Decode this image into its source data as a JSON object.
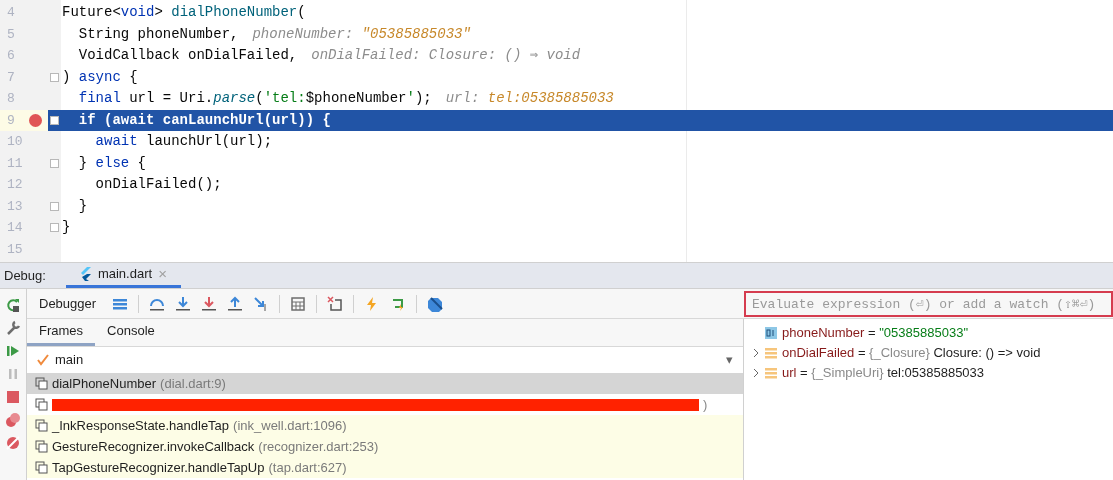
{
  "editor": {
    "lines": [
      {
        "number": "4",
        "breakpoint": false,
        "current": false,
        "fold": false,
        "tokens": [
          {
            "text": "Future<",
            "kind": "plain"
          },
          {
            "text": "void",
            "kind": "keyword"
          },
          {
            "text": "> ",
            "kind": "plain"
          },
          {
            "text": "dialPhoneNumber",
            "kind": "function"
          },
          {
            "text": "(",
            "kind": "plain"
          }
        ]
      },
      {
        "number": "5",
        "breakpoint": false,
        "current": false,
        "fold": false,
        "tokens": [
          {
            "text": "  String phoneNumber,",
            "kind": "plain"
          }
        ],
        "hint": [
          {
            "text": "phoneNumber: ",
            "kind": "label"
          },
          {
            "text": "\"05385885033\"",
            "kind": "value"
          }
        ]
      },
      {
        "number": "6",
        "breakpoint": false,
        "current": false,
        "fold": false,
        "tokens": [
          {
            "text": "  VoidCallback onDialFailed,",
            "kind": "plain"
          }
        ],
        "hint": [
          {
            "text": "onDialFailed: Closure: () ⇒ void",
            "kind": "label"
          }
        ]
      },
      {
        "number": "7",
        "breakpoint": false,
        "current": false,
        "fold": true,
        "tokens": [
          {
            "text": ") ",
            "kind": "plain"
          },
          {
            "text": "async",
            "kind": "keyword"
          },
          {
            "text": " {",
            "kind": "plain"
          }
        ]
      },
      {
        "number": "8",
        "breakpoint": false,
        "current": false,
        "fold": false,
        "tokens": [
          {
            "text": "  final",
            "kind": "keyword"
          },
          {
            "text": " url = Uri.",
            "kind": "plain"
          },
          {
            "text": "parse",
            "kind": "method"
          },
          {
            "text": "(",
            "kind": "plain"
          },
          {
            "text": "'tel:",
            "kind": "string"
          },
          {
            "text": "$phoneNumber",
            "kind": "plain"
          },
          {
            "text": "'",
            "kind": "string"
          },
          {
            "text": ");",
            "kind": "plain"
          }
        ],
        "hint": [
          {
            "text": "url: ",
            "kind": "label"
          },
          {
            "text": "tel:05385885033",
            "kind": "value"
          }
        ]
      },
      {
        "number": "9",
        "breakpoint": true,
        "current": true,
        "fold": true,
        "tokens": [
          {
            "text": "  if (await canLaunchUrl(url)) {",
            "kind": "plain"
          }
        ]
      },
      {
        "number": "10",
        "breakpoint": false,
        "current": false,
        "fold": false,
        "tokens": [
          {
            "text": "    await",
            "kind": "keyword"
          },
          {
            "text": " launchUrl(url);",
            "kind": "plain"
          }
        ]
      },
      {
        "number": "11",
        "breakpoint": false,
        "current": false,
        "fold": true,
        "tokens": [
          {
            "text": "  } ",
            "kind": "plain"
          },
          {
            "text": "else",
            "kind": "keyword"
          },
          {
            "text": " {",
            "kind": "plain"
          }
        ]
      },
      {
        "number": "12",
        "breakpoint": false,
        "current": false,
        "fold": false,
        "tokens": [
          {
            "text": "    onDialFailed();",
            "kind": "plain"
          }
        ]
      },
      {
        "number": "13",
        "breakpoint": false,
        "current": false,
        "fold": true,
        "tokens": [
          {
            "text": "  }",
            "kind": "plain"
          }
        ]
      },
      {
        "number": "14",
        "breakpoint": false,
        "current": false,
        "fold": true,
        "tokens": [
          {
            "text": "}",
            "kind": "plain"
          }
        ]
      },
      {
        "number": "15",
        "breakpoint": false,
        "current": false,
        "fold": false
      }
    ]
  },
  "debug_bar": {
    "label": "Debug:",
    "tab": "main.dart",
    "close": "×"
  },
  "toolbar": {
    "label": "Debugger"
  },
  "tabs": [
    {
      "label": "Frames",
      "selected": true
    },
    {
      "label": "Console",
      "selected": false
    }
  ],
  "thread": {
    "name": "main",
    "dropdown": "▾"
  },
  "frames": [
    {
      "kind": "user",
      "selected": true,
      "redacted": false,
      "name": "dialPhoneNumber",
      "location": "(dial.dart:9)"
    },
    {
      "kind": "user",
      "selected": false,
      "redacted": true,
      "location": ")"
    },
    {
      "kind": "library",
      "selected": false,
      "redacted": false,
      "name": "_InkResponseState.handleTap",
      "location": "(ink_well.dart:1096)"
    },
    {
      "kind": "library",
      "selected": false,
      "redacted": false,
      "name": "GestureRecognizer.invokeCallback",
      "location": "(recognizer.dart:253)"
    },
    {
      "kind": "library",
      "selected": false,
      "redacted": false,
      "name": "TapGestureRecognizer.handleTapUp",
      "location": "(tap.dart:627)"
    }
  ],
  "watch": {
    "placeholder": "Evaluate expression (⏎) or add a watch (⇧⌘⏎)"
  },
  "variables": [
    {
      "kind": "primitive",
      "name": "phoneNumber",
      "separator": "=",
      "value": "\"05385885033\""
    },
    {
      "kind": "object",
      "expanded": false,
      "name": "onDialFailed",
      "separator": "=",
      "type": "{_Closure}",
      "value": "Closure: () => void"
    },
    {
      "kind": "object",
      "expanded": false,
      "name": "url",
      "separator": "=",
      "type": "{_SimpleUri}",
      "value": "tel:05385885033"
    }
  ]
}
